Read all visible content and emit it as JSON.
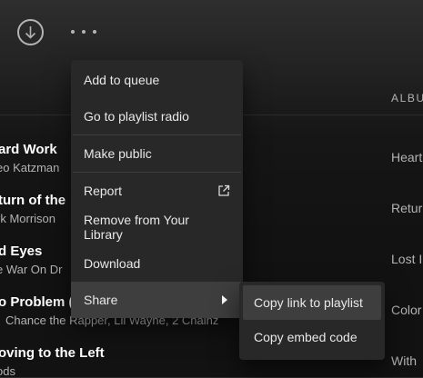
{
  "header": {
    "album_column": "ALBUM"
  },
  "tracks": [
    {
      "title": "ard Work",
      "artist": "eo Katzman",
      "album": "Heart"
    },
    {
      "title": "turn of the",
      "artist": "rk Morrison",
      "album": "Retur"
    },
    {
      "title": "d Eyes",
      "artist": "e War On Dr",
      "album": "Lost I"
    },
    {
      "title": "o Problem (",
      "artist": "Chance the Rapper, Lil Wayne, 2 Chainz",
      "album": "Color"
    },
    {
      "title": "oving to the Left",
      "artist": "ods",
      "album": "With"
    }
  ],
  "context_menu": {
    "items": [
      {
        "label": "Add to queue"
      },
      {
        "label": "Go to playlist radio"
      },
      {
        "label": "Make public"
      },
      {
        "label": "Report",
        "icon": "external-link-icon"
      },
      {
        "label": "Remove from Your Library"
      },
      {
        "label": "Download"
      },
      {
        "label": "Share",
        "icon": "caret-right-icon"
      }
    ]
  },
  "share_submenu": {
    "items": [
      {
        "label": "Copy link to playlist"
      },
      {
        "label": "Copy embed code"
      }
    ]
  },
  "colors": {
    "menu_bg": "#282828",
    "hover_bg": "#3e3e3e",
    "secondary_text": "#b3b3b3"
  }
}
